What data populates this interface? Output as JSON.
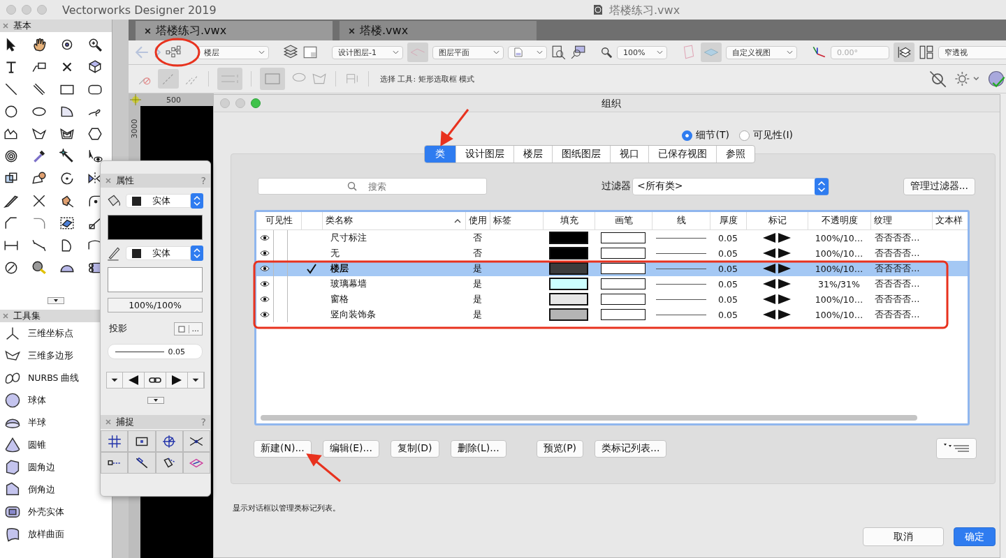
{
  "app_title": "Vectorworks Designer 2019",
  "document_title": "塔楼练习.vwx",
  "basic_palette": {
    "title": "基本"
  },
  "document_tabs": [
    {
      "label": "塔楼练习.vwx",
      "selected": true
    },
    {
      "label": "塔楼.vwx",
      "selected": false
    }
  ],
  "view_bar": {
    "story": "楼层",
    "layer": "设计图层-1",
    "view": "图层平面",
    "zoom": "100%",
    "render_view": "自定义视图",
    "angle": "0.00°",
    "projection": "窄透视"
  },
  "mode_bar": {
    "hint": "选择 工具: 矩形选取框 模式"
  },
  "ruler": {
    "x_label": "500",
    "y_label": "3000"
  },
  "toolsets": {
    "title": "工具集",
    "items": [
      "三维坐标点",
      "三维多边形",
      "NURBS 曲线",
      "球体",
      "半球",
      "圆锥",
      "圆角边",
      "倒角边",
      "外壳实体",
      "放样曲面"
    ]
  },
  "attributes": {
    "title": "属性",
    "help": "?",
    "fill_style": "实体",
    "pen_style": "实体",
    "opacity": "100%/100%",
    "shadow_label": "投影",
    "shadow_more": "...",
    "thickness": "0.05"
  },
  "snapping": {
    "title": "捕捉",
    "help": "?"
  },
  "dialog": {
    "title": "组织",
    "modes": [
      {
        "label": "细节(T)",
        "selected": true
      },
      {
        "label": "可见性(I)",
        "selected": false
      }
    ],
    "tabs": [
      {
        "label": "类",
        "selected": true
      },
      {
        "label": "设计图层",
        "selected": false
      },
      {
        "label": "楼层",
        "selected": false
      },
      {
        "label": "图纸图层",
        "selected": false
      },
      {
        "label": "视口",
        "selected": false
      },
      {
        "label": "已保存视图",
        "selected": false
      },
      {
        "label": "参照",
        "selected": false
      }
    ],
    "search_placeholder": "搜索",
    "filter_label": "过滤器",
    "filter_value": "<所有类>",
    "manage_filters": "管理过滤器...",
    "columns": [
      "可见性",
      "类名称",
      "使用",
      "标签",
      "填充",
      "画笔",
      "线",
      "厚度",
      "标记",
      "不透明度",
      "纹理",
      "文本样"
    ],
    "rows": [
      {
        "visible": true,
        "active": false,
        "selected": false,
        "name": "尺寸标注",
        "use": "否",
        "color": "#000000",
        "thickness": "0.05",
        "opacity": "100%/10…",
        "texture": "否否否否…"
      },
      {
        "visible": true,
        "active": false,
        "selected": false,
        "name": "无",
        "use": "否",
        "color": "#000000",
        "thickness": "0.05",
        "opacity": "100%/10…",
        "texture": "否否否否…"
      },
      {
        "visible": true,
        "active": true,
        "selected": true,
        "name": "楼层",
        "use": "是",
        "color": "#3c3c3c",
        "thickness": "0.05",
        "opacity": "100%/10…",
        "texture": "否否否否…"
      },
      {
        "visible": true,
        "active": false,
        "selected": false,
        "name": "玻璃幕墙",
        "use": "是",
        "color": "#ccffff",
        "thickness": "0.05",
        "opacity": "31%/31%",
        "texture": "否否否否…"
      },
      {
        "visible": true,
        "active": false,
        "selected": false,
        "name": "窗格",
        "use": "是",
        "color": "#e6e6e6",
        "thickness": "0.05",
        "opacity": "100%/10…",
        "texture": "否否否否…"
      },
      {
        "visible": true,
        "active": false,
        "selected": false,
        "name": "竖向装饰条",
        "use": "是",
        "color": "#b4b4b4",
        "thickness": "0.05",
        "opacity": "100%/10…",
        "texture": "否否否否…"
      }
    ],
    "buttons": [
      "新建(N)...",
      "编辑(E)...",
      "复制(D)",
      "删除(L)...",
      "预览(P)",
      "类标记列表..."
    ],
    "status": "显示对话框以管理类标记列表。",
    "cancel": "取消",
    "ok": "确定"
  }
}
